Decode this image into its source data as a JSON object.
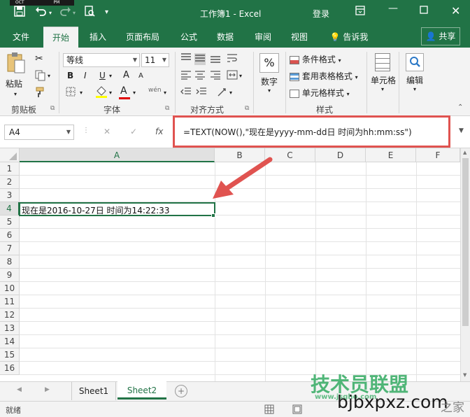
{
  "titlebar": {
    "title": "工作簿1  -  Excel",
    "login": "登录",
    "clock_text": "OCT",
    "clock_pm": "PM"
  },
  "tabs": [
    {
      "label": "文件"
    },
    {
      "label": "开始"
    },
    {
      "label": "插入"
    },
    {
      "label": "页面布局"
    },
    {
      "label": "公式"
    },
    {
      "label": "数据"
    },
    {
      "label": "审阅"
    },
    {
      "label": "视图"
    },
    {
      "label": "告诉我"
    }
  ],
  "share_label": "共享",
  "ribbon": {
    "paste": "粘贴",
    "clipboard": "剪贴板",
    "font_name": "等线",
    "font_size": "11",
    "font_group": "字体",
    "bold": "B",
    "italic": "I",
    "underline": "U",
    "font_color_letter": "A",
    "font_grow": "A",
    "font_shrink": "A",
    "wen": "wén",
    "align_group": "对齐方式",
    "number": "数字",
    "number_percent": "%",
    "cond_format": "条件格式",
    "table_format": "套用表格格式",
    "cell_style": "单元格样式",
    "style_group": "样式",
    "cells": "单元格",
    "edit": "编辑"
  },
  "formula_bar": {
    "name_box": "A4",
    "fx": "fx",
    "cancel": "✕",
    "enter": "✓",
    "formula": "=TEXT(NOW(),\"现在是yyyy-mm-dd日 时间为hh:mm:ss\")"
  },
  "grid": {
    "columns": [
      "A",
      "B",
      "C",
      "D",
      "E",
      "F"
    ],
    "rows": [
      "1",
      "2",
      "3",
      "4",
      "5",
      "6",
      "7",
      "8",
      "9",
      "10",
      "11",
      "12",
      "13",
      "14",
      "15",
      "16"
    ],
    "cell_a4": "现在是2016-10-27日 时间为14:22:33",
    "selected_cell": "A4"
  },
  "sheets": [
    {
      "label": "Sheet1"
    },
    {
      "label": "Sheet2"
    }
  ],
  "status": {
    "ready": "就绪"
  },
  "watermark": {
    "line1": "技术员联盟",
    "line2": "www.jsgho.com",
    "line3": "bjbxpxz.com",
    "line4": "之家"
  },
  "colors": {
    "excel_green": "#217346",
    "highlight_red": "#e05350"
  }
}
